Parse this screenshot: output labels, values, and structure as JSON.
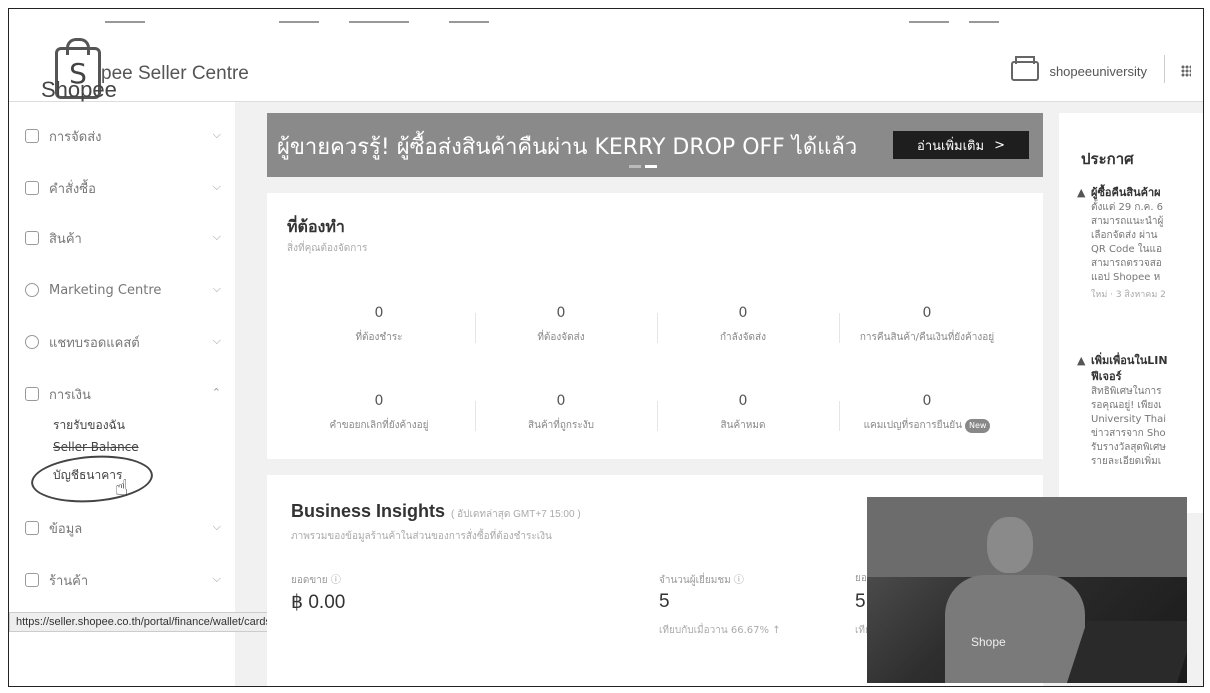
{
  "header": {
    "logo_letter": "S",
    "logo_text": "Shopee",
    "app_title": "pee Seller Centre",
    "username": "shopeeuniversity"
  },
  "sidebar": {
    "items": [
      {
        "label": "การจัดส่ง",
        "chevron": "⌵"
      },
      {
        "label": "คำสั่งซื้อ",
        "chevron": "⌵"
      },
      {
        "label": "สินค้า",
        "chevron": "⌵"
      },
      {
        "label": "Marketing Centre",
        "chevron": "⌵"
      },
      {
        "label": "แชทบรอดแคสต์",
        "chevron": "⌵"
      },
      {
        "label": "การเงิน",
        "chevron": "⌃"
      },
      {
        "label": "ข้อมูล",
        "chevron": "⌵"
      },
      {
        "label": "ร้านค้า",
        "chevron": "⌵"
      }
    ],
    "finance_sub": [
      "รายรับของฉัน",
      "Seller Balance",
      "บัญชีธนาคาร"
    ]
  },
  "status_url": "https://seller.shopee.co.th/portal/finance/wallet/cards",
  "banner": {
    "text": "ผู้ขายควรรู้! ผู้ซื้อส่งสินค้าคืนผ่าน KERRY DROP OFF ได้แล้ว",
    "button": "อ่านเพิ่มเติม",
    "button_arrow": ">"
  },
  "todo": {
    "title": "ที่ต้องทำ",
    "subtitle": "สิ่งที่คุณต้องจัดการ",
    "items": [
      {
        "value": "0",
        "label": "ที่ต้องชำระ"
      },
      {
        "value": "0",
        "label": "ที่ต้องจัดส่ง"
      },
      {
        "value": "0",
        "label": "กำลังจัดส่ง"
      },
      {
        "value": "0",
        "label": "การคืนสินค้า/คืนเงินที่ยังค้างอยู่"
      },
      {
        "value": "0",
        "label": "คำขอยกเลิกที่ยังค้างอยู่"
      },
      {
        "value": "0",
        "label": "สินค้าที่ถูกระงับ"
      },
      {
        "value": "0",
        "label": "สินค้าหมด"
      },
      {
        "value": "0",
        "label": "แคมเปญที่รอการยืนยัน"
      }
    ],
    "new_badge": "New"
  },
  "insights": {
    "title": "Business Insights",
    "updated": "( อัปเดทล่าสุด GMT+7 15:00 )",
    "subtitle": "ภาพรวมของข้อมูลร้านค้าในส่วนของการสั่งซื้อที่ต้องชำระเงิน",
    "metrics": [
      {
        "label": "ยอดขาย ⓘ",
        "value": "฿ 0.00",
        "compare": ""
      },
      {
        "label": "จำนวนผู้เยี่ยมชม ⓘ",
        "value": "5",
        "compare": "เทียบกับเมื่อวาน 66.67% ↑"
      },
      {
        "label": "ยอด",
        "value": "5",
        "compare": "เทียบ"
      }
    ]
  },
  "announcements": {
    "title": "ประกาศ",
    "items": [
      {
        "head": "ผู้ซื้อคืนสินค้าผ",
        "lines": [
          "ตั้งแต่ 29 ก.ค. 6",
          "สามารถแนะนำผู้",
          "เลือกจัดส่ง ผ่าน",
          "QR Code ในแอ",
          "สามารถตรวจสอ",
          "แอป Shopee ห"
        ],
        "time": "ใหม่ · 3 สิงหาคม 2"
      },
      {
        "head": "เพิ่มเพื่อนในLIN",
        "head2": "ฟีเจอร์",
        "lines": [
          "สิทธิพิเศษในการ",
          "รอคุณอยู่! เพียงเ",
          "University Thai",
          "ข่าวสารจาก Sho",
          "รับรางวัลสุดพิเศษ",
          "รายละเอียดเพิ่มเ"
        ],
        "time": ""
      }
    ]
  },
  "video": {
    "shirt_text": "Shope"
  }
}
